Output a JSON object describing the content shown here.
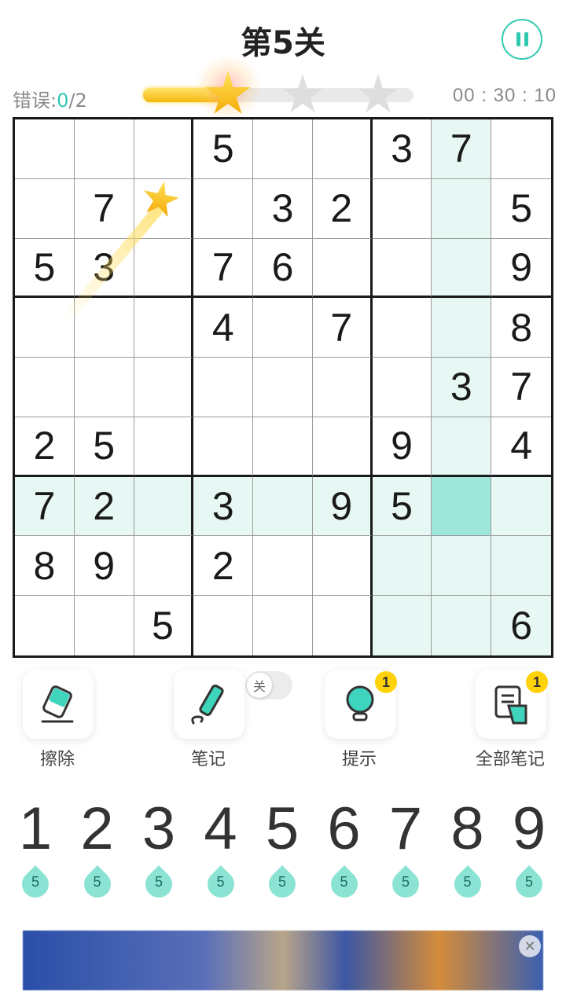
{
  "header": {
    "title": "第5关",
    "errors_label": "错误:",
    "errors_current": "0",
    "errors_sep_max": "/2",
    "timer": "00 : 30 : 10",
    "stars_total": 3,
    "stars_earned": 1
  },
  "board": {
    "cells": [
      [
        "",
        "",
        "",
        "5",
        "",
        "",
        "3",
        "7",
        ""
      ],
      [
        "",
        "7",
        "",
        "",
        "3",
        "2",
        "",
        "",
        "5"
      ],
      [
        "5",
        "3",
        "",
        "7",
        "6",
        "",
        "",
        "",
        "9"
      ],
      [
        "",
        "",
        "",
        "4",
        "",
        "7",
        "",
        "",
        "8"
      ],
      [
        "",
        "",
        "",
        "",
        "",
        "",
        "",
        "3",
        "7"
      ],
      [
        "2",
        "5",
        "",
        "",
        "",
        "",
        "9",
        "",
        "4"
      ],
      [
        "7",
        "2",
        "",
        "3",
        "",
        "9",
        "5",
        "",
        ""
      ],
      [
        "8",
        "9",
        "",
        "2",
        "",
        "",
        "",
        "",
        ""
      ],
      [
        "",
        "",
        "5",
        "",
        "",
        "",
        "",
        "",
        "6"
      ]
    ],
    "selected_row": 6,
    "selected_col": 7
  },
  "tools": {
    "erase": "擦除",
    "notes": "笔记",
    "notes_toggle": "关",
    "hint": "提示",
    "hint_count": "1",
    "all_notes": "全部笔记",
    "all_notes_count": "1"
  },
  "numpad": [
    {
      "digit": "1",
      "remaining": "5"
    },
    {
      "digit": "2",
      "remaining": "5"
    },
    {
      "digit": "3",
      "remaining": "5"
    },
    {
      "digit": "4",
      "remaining": "5"
    },
    {
      "digit": "5",
      "remaining": "5"
    },
    {
      "digit": "6",
      "remaining": "5"
    },
    {
      "digit": "7",
      "remaining": "5"
    },
    {
      "digit": "8",
      "remaining": "5"
    },
    {
      "digit": "9",
      "remaining": "5"
    }
  ],
  "colors": {
    "accent": "#2fc9b0",
    "highlight": "#e6f7f4",
    "selected": "#9fe6da",
    "badge": "#ffd20a"
  }
}
